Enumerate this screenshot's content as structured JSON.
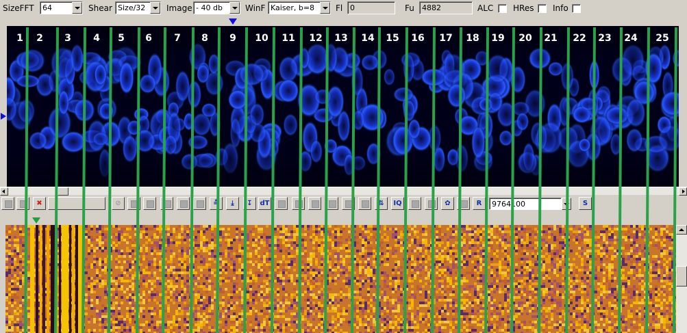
{
  "params": {
    "sizefft_label": "SizeFFT",
    "sizefft_value": "64",
    "shear_label": "Shear",
    "shear_value": "Size/32",
    "image_label": "Image",
    "image_value": "- 40 db",
    "winf_label": "WinF",
    "winf_value": "Kaiser, b=8",
    "fl_label": "Fl",
    "fl_value": "0",
    "fu_label": "Fu",
    "fu_value": "4882",
    "alc_label": "ALC",
    "hres_label": "HRes",
    "info_label": "Info"
  },
  "toolbar": {
    "dt_label": "dT",
    "iq_label": "IQ",
    "r_label": "R",
    "s_label": "S",
    "frequency_value": "9764100"
  },
  "channels": [
    "1",
    "2",
    "3",
    "4",
    "5",
    "6",
    "7",
    "8",
    "9",
    "10",
    "11",
    "12",
    "13",
    "14",
    "15",
    "16",
    "17",
    "18",
    "19",
    "20",
    "21",
    "22",
    "23",
    "24",
    "25"
  ],
  "colors": {
    "spectrum_bg": "#000018",
    "spectrum_blue": "#2a5cff",
    "waterfall_a": "#f5b800",
    "waterfall_b": "#5a2a6a",
    "line_green": "#2aa24a",
    "marker_blue": "#1010e0"
  }
}
